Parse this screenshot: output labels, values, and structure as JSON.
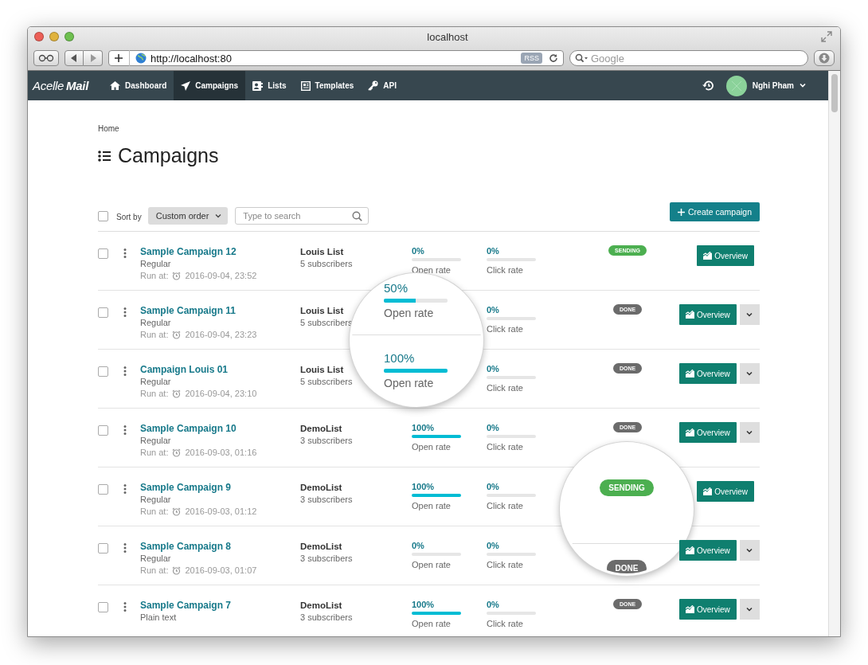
{
  "browser": {
    "title": "localhost",
    "url": "http://localhost:80",
    "rss": "RSS",
    "search_placeholder": "Google"
  },
  "nav": {
    "logo": [
      "Acelle",
      "Mail"
    ],
    "items": [
      {
        "label": "Dashboard",
        "kind": "home",
        "selected": false
      },
      {
        "label": "Campaigns",
        "kind": "send",
        "selected": true
      },
      {
        "label": "Lists",
        "kind": "card",
        "selected": false
      },
      {
        "label": "Templates",
        "kind": "doc",
        "selected": false
      },
      {
        "label": "API",
        "kind": "key",
        "selected": false
      }
    ],
    "user": "Nghi Pham"
  },
  "page": {
    "breadcrumb": "Home",
    "title": "Campaigns",
    "sort_label": "Sort by",
    "sort_value": "Custom order",
    "search_placeholder": "Type to search",
    "create_label": "Create campaign",
    "select_all_checked": false
  },
  "rows": [
    {
      "name": "Sample Campaign 12",
      "type": "Regular",
      "run_label": "Run at:",
      "run_at": "2016-09-04, 23:52",
      "list": "Louis List",
      "subscribers": "5 subscribers",
      "checked": false,
      "open": {
        "value": "0%",
        "level": 0,
        "label": "Open rate",
        "magnified": false
      },
      "click": {
        "value": "0%",
        "level": 0,
        "label": "Click rate"
      },
      "status": {
        "label": "SENDING",
        "kind": "sending",
        "magnified": false
      },
      "overview": "Overview",
      "menu": false
    },
    {
      "name": "Sample Campaign 11",
      "type": "Regular",
      "run_label": "Run at:",
      "run_at": "2016-09-04, 23:23",
      "list": "Louis List",
      "subscribers": "5 subscribers",
      "checked": false,
      "open": {
        "value": "50%",
        "level": 0.5,
        "label": "Open rate",
        "magnified": true
      },
      "click": {
        "value": "0%",
        "level": 0,
        "label": "Click rate"
      },
      "status": {
        "label": "DONE",
        "kind": "done",
        "magnified": false
      },
      "overview": "Overview",
      "menu": true
    },
    {
      "name": "Campaign Louis 01",
      "type": "Regular",
      "run_label": "Run at:",
      "run_at": "2016-09-04, 23:10",
      "list": "Louis List",
      "subscribers": "5 subscribers",
      "checked": false,
      "open": {
        "value": "100%",
        "level": 1,
        "label": "Open rate",
        "magnified": true
      },
      "click": {
        "value": "0%",
        "level": 0,
        "label": "Click rate"
      },
      "status": {
        "label": "DONE",
        "kind": "done",
        "magnified": false
      },
      "overview": "Overview",
      "menu": true
    },
    {
      "name": "Sample Campaign 10",
      "type": "Regular",
      "run_label": "Run at:",
      "run_at": "2016-09-03, 01:16",
      "list": "DemoList",
      "subscribers": "3 subscribers",
      "checked": false,
      "open": {
        "value": "100%",
        "level": 1,
        "label": "Open rate",
        "magnified": false
      },
      "click": {
        "value": "0%",
        "level": 0,
        "label": "Click rate"
      },
      "status": {
        "label": "DONE",
        "kind": "done",
        "magnified": false
      },
      "overview": "Overview",
      "menu": true
    },
    {
      "name": "Sample Campaign 9",
      "type": "Regular",
      "run_label": "Run at:",
      "run_at": "2016-09-03, 01:12",
      "list": "DemoList",
      "subscribers": "3 subscribers",
      "checked": false,
      "open": {
        "value": "100%",
        "level": 1,
        "label": "Open rate",
        "magnified": false
      },
      "click": {
        "value": "0%",
        "level": 0,
        "label": "Click rate"
      },
      "status": {
        "label": "SENDING",
        "kind": "sending",
        "magnified": true
      },
      "overview": "Overview",
      "menu": false
    },
    {
      "name": "Sample Campaign 8",
      "type": "Regular",
      "run_label": "Run at:",
      "run_at": "2016-09-03, 01:07",
      "list": "DemoList",
      "subscribers": "3 subscribers",
      "checked": false,
      "open": {
        "value": "0%",
        "level": 0,
        "label": "Open rate",
        "magnified": false
      },
      "click": {
        "value": "0%",
        "level": 0,
        "label": "Click rate"
      },
      "status": {
        "label": "DONE",
        "kind": "done",
        "magnified": true
      },
      "overview": "Overview",
      "menu": true
    },
    {
      "name": "Sample Campaign 7",
      "type": "Plain text",
      "list": "DemoList",
      "subscribers": "3 subscribers",
      "checked": false,
      "open": {
        "value": "100%",
        "level": 1,
        "label": "Open rate",
        "magnified": false
      },
      "click": {
        "value": "0%",
        "level": 0,
        "label": "Click rate"
      },
      "status": {
        "label": "DONE",
        "kind": "done",
        "magnified": false
      },
      "overview": "Overview",
      "menu": true
    }
  ]
}
